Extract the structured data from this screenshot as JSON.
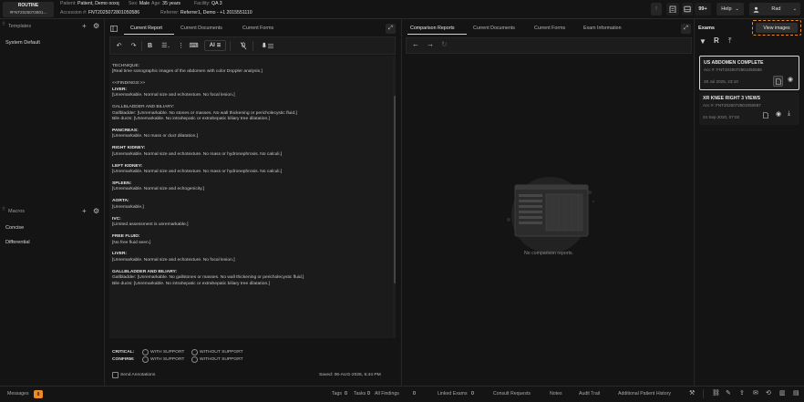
{
  "patient": {
    "routine": "ROUTINE",
    "accession_short": "#FNT2025072801...",
    "patient_label": "Patient:",
    "patient_name": "Patient, Demo ooxq",
    "sex_label": "Sex:",
    "sex": "Male",
    "age_label": "Age:",
    "age": "35 years",
    "facility_label": "Facility:",
    "facility": "QA 3",
    "accession_label": "Accession #:",
    "accession": "FNT2025072801050586",
    "referrer_label": "Referrer:",
    "referrer": "Referrer1, Demo - +1 2015551110"
  },
  "topbar": {
    "count_badge": "99+",
    "help_label": "Help",
    "user_label": "Rad"
  },
  "left": {
    "templates_label": "Templates",
    "template_items": [
      "System Default"
    ],
    "macros_label": "Macros",
    "macro_items": [
      "Concise",
      "Differential"
    ]
  },
  "editor": {
    "tabs": [
      "Current Report",
      "Current Documents",
      "Current Forms"
    ],
    "ai_label": "AI",
    "lines": [
      {
        "t": "TECHNIQUE:",
        "b": false
      },
      {
        "t": "[Real time sonographic images of the abdomen with color Doppler analysis.]",
        "b": false
      },
      {
        "t": "",
        "b": false
      },
      {
        "t": "<<FINDINGS:>>",
        "b": false
      },
      {
        "t": "LIVER:",
        "b": true
      },
      {
        "t": "[Unremarkable. Normal size and echotexture. No focal lesion.]",
        "b": false
      },
      {
        "t": "",
        "b": false
      },
      {
        "t": "GALLBLADDER AND BILIARY:",
        "b": false
      },
      {
        "t": "Gallbladder: [Unremarkable. No stones or masses. No wall thickening or pericholecystic fluid.]",
        "b": false
      },
      {
        "t": "Bile ducts: [Unremarkable. No intrahepatic or extrahepatic biliary tree dilatation.]",
        "b": false
      },
      {
        "t": "",
        "b": false
      },
      {
        "t": "PANCREAS:",
        "b": true
      },
      {
        "t": "[Unremarkable. No mass or duct dilatation.]",
        "b": false
      },
      {
        "t": "",
        "b": false
      },
      {
        "t": "RIGHT KIDNEY:",
        "b": true
      },
      {
        "t": "[Unremarkable. Normal size and echotexture. No mass or hydronephrosis. No calculi.]",
        "b": false
      },
      {
        "t": "",
        "b": false
      },
      {
        "t": "LEFT KIDNEY:",
        "b": true
      },
      {
        "t": "[Unremarkable. Normal size and echotexture. No mass or hydronephrosis. No calculi.]",
        "b": false
      },
      {
        "t": "",
        "b": false
      },
      {
        "t": "SPLEEN:",
        "b": true
      },
      {
        "t": "[Unremarkable. Normal size and echogenicity.]",
        "b": false
      },
      {
        "t": "",
        "b": false
      },
      {
        "t": "AORTA:",
        "b": true
      },
      {
        "t": "[Unremarkable.]",
        "b": false
      },
      {
        "t": "",
        "b": false
      },
      {
        "t": "IVC:",
        "b": true
      },
      {
        "t": "[Limited assessment is unremarkable.]",
        "b": false
      },
      {
        "t": "",
        "b": false
      },
      {
        "t": "FREE FLUID:",
        "b": true
      },
      {
        "t": "[No free fluid seen.]",
        "b": false
      },
      {
        "t": "",
        "b": false
      },
      {
        "t": "LIVER:",
        "b": true
      },
      {
        "t": "[Unremarkable. Normal size and echotexture. No focal lesion.]",
        "b": false
      },
      {
        "t": "",
        "b": false
      },
      {
        "t": "GALLBLADDER AND BILIARY:",
        "b": true
      },
      {
        "t": "Gallbladder: [Unremarkable. No gallstones or masses. No wall thickening or pericholecystic fluid.]",
        "b": false
      },
      {
        "t": "Bile ducts: [Unremarkable. No intrahepatic or extrahepatic biliary tree dilatation.]",
        "b": false
      }
    ],
    "critical_label": "CRITICAL:",
    "confirm_label": "CONFIRM:",
    "with_support": "WITH SUPPORT",
    "without_support": "WITHOUT SUPPORT",
    "send_annotations": "Send Annotations",
    "saved_status": "Saved: 06-AUG-2026, 5:44 PM"
  },
  "compare": {
    "tabs": [
      "Comparison Reports",
      "Current Documents",
      "Current Forms",
      "Exam Information"
    ],
    "empty_text": "No comparison reports."
  },
  "exams": {
    "title": "Exams",
    "view_images": "View images",
    "cards": [
      {
        "title": "US ABDOMEN COMPLETE",
        "acc": "Acc #: FNT2025072801050586",
        "date": "28 Jul 2025, 23:10"
      },
      {
        "title": "XR KNEE RIGHT 3 VIEWS",
        "acc": "Acc #: FNT2025072801050587",
        "date": "24 Sep 2020, 07:02"
      }
    ]
  },
  "bottom": {
    "messages": "Messages",
    "messages_count": "0",
    "tags": "Tags",
    "tags_count": "0",
    "tasks": "Tasks",
    "tasks_count": "0",
    "all_findings": "All Findings",
    "all_findings_count": "0",
    "linked_exams": "Linked Exams",
    "linked_count": "0",
    "consult_requests": "Consult Requests",
    "notes": "Notes",
    "audit_trail": "Audit Trail",
    "additional_history": "Additional Patient History"
  },
  "colors": {
    "accent": "#f08a24",
    "bg": "#141414",
    "panel": "#1b1b1b"
  }
}
